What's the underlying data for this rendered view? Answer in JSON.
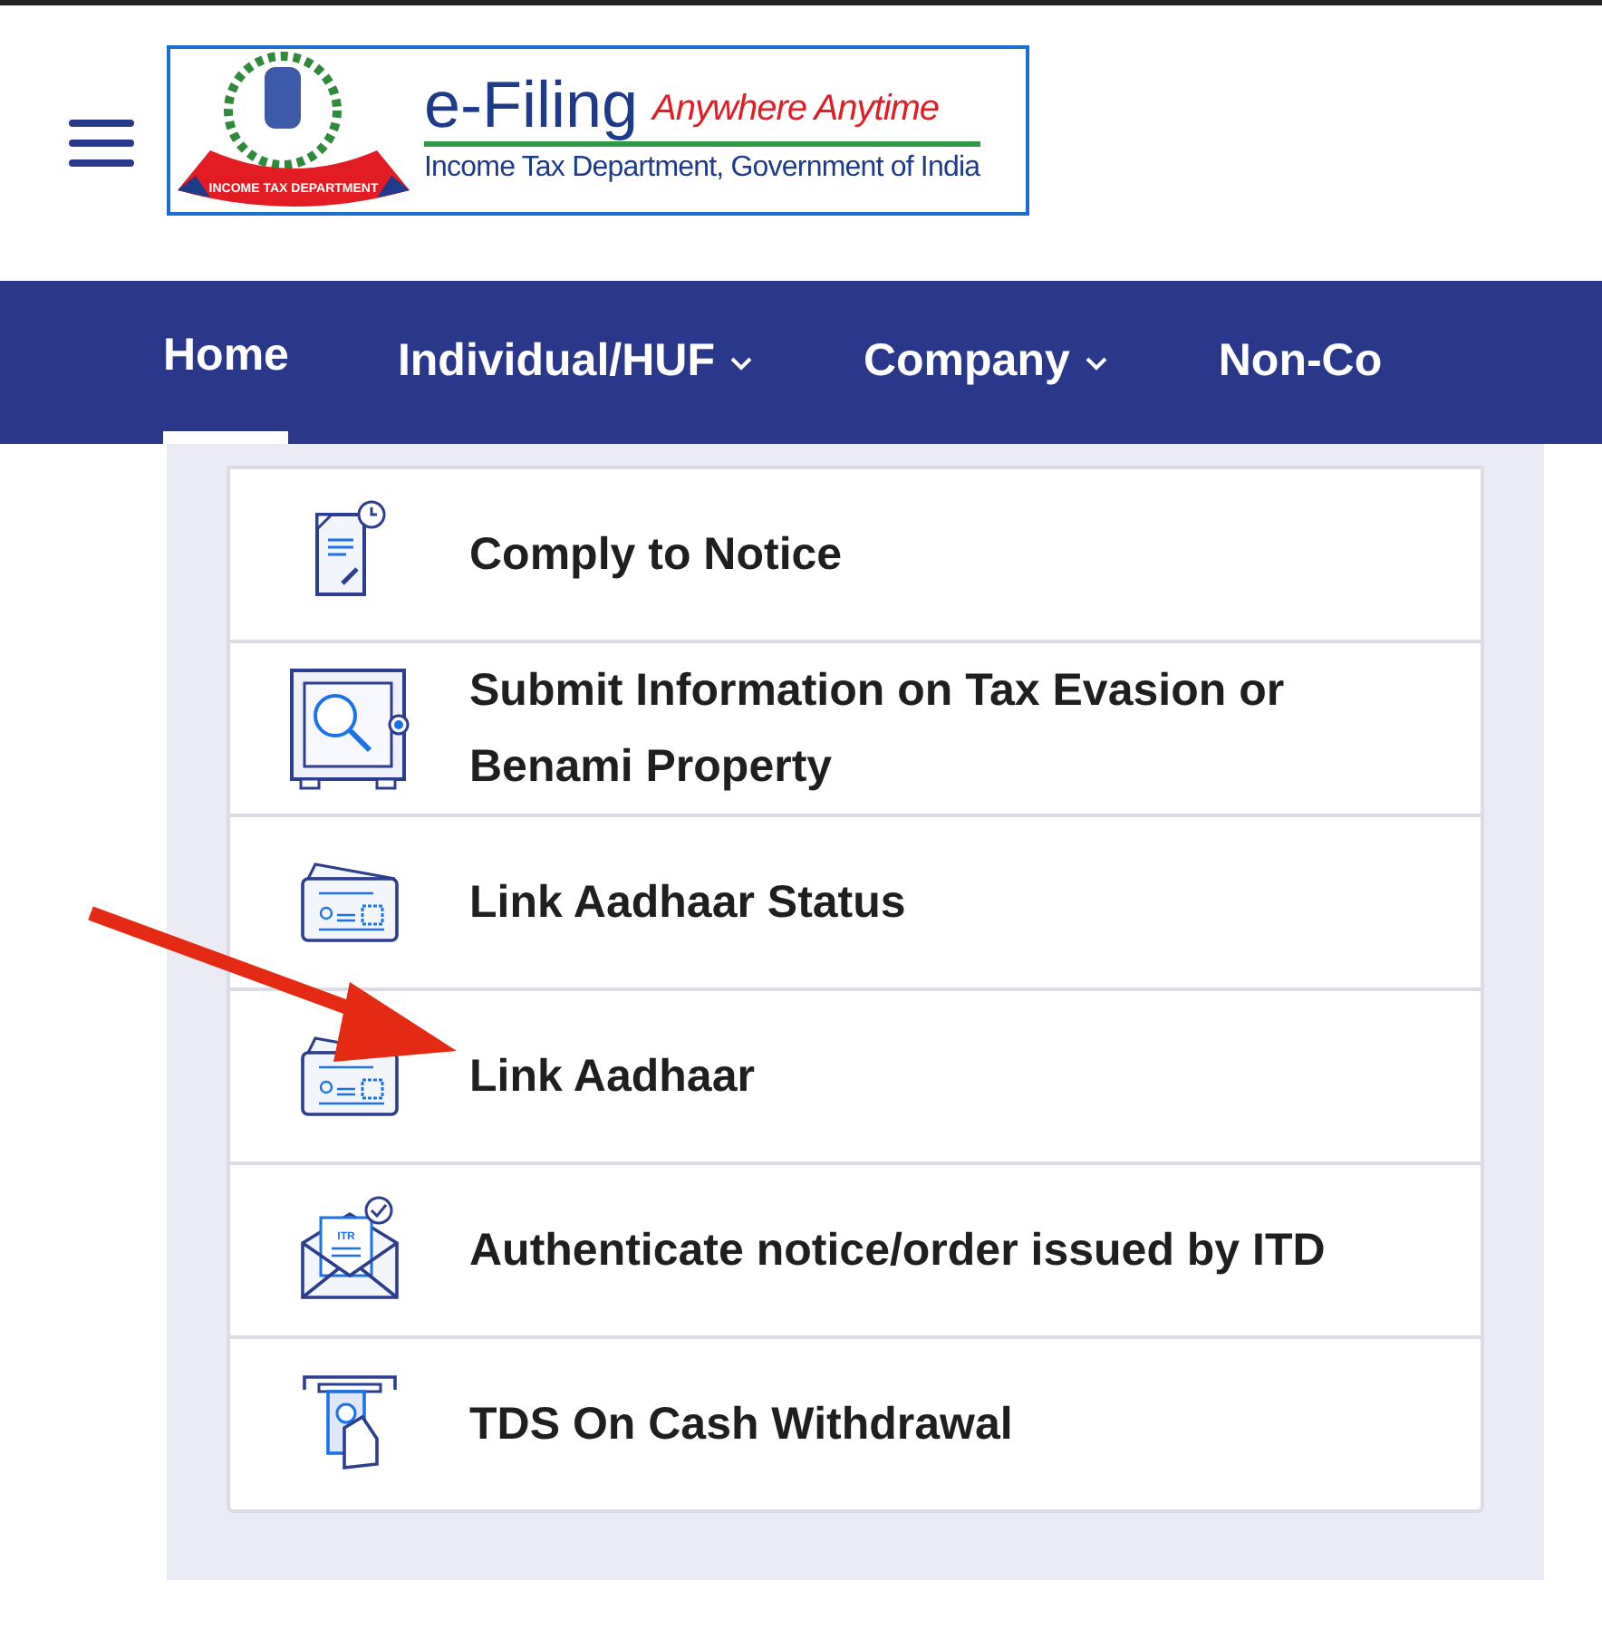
{
  "header": {
    "logo": {
      "title": "e-Filing",
      "tagline": "Anywhere Anytime",
      "subtitle": "Income Tax Department, Government of India",
      "ribbon": "INCOME TAX DEPARTMENT"
    }
  },
  "nav": [
    {
      "label": "Home",
      "selected": true,
      "dropdown": false
    },
    {
      "label": "Individual/HUF",
      "selected": false,
      "dropdown": true
    },
    {
      "label": "Company",
      "selected": false,
      "dropdown": true
    },
    {
      "label": "Non-Co",
      "selected": false,
      "dropdown": false
    }
  ],
  "services": [
    {
      "label": "Comply to Notice",
      "kind": "document",
      "pointed": false
    },
    {
      "label": "Submit Information on Tax Evasion or Benami Property",
      "kind": "safe",
      "pointed": false
    },
    {
      "label": "Link Aadhaar Status",
      "kind": "card",
      "pointed": false
    },
    {
      "label": "Link Aadhaar",
      "kind": "card",
      "pointed": true
    },
    {
      "label": "Authenticate notice/order issued by ITD",
      "kind": "envelope",
      "icon_text": "ITR",
      "pointed": false
    },
    {
      "label": "TDS On Cash Withdrawal",
      "kind": "atm",
      "pointed": false
    }
  ]
}
